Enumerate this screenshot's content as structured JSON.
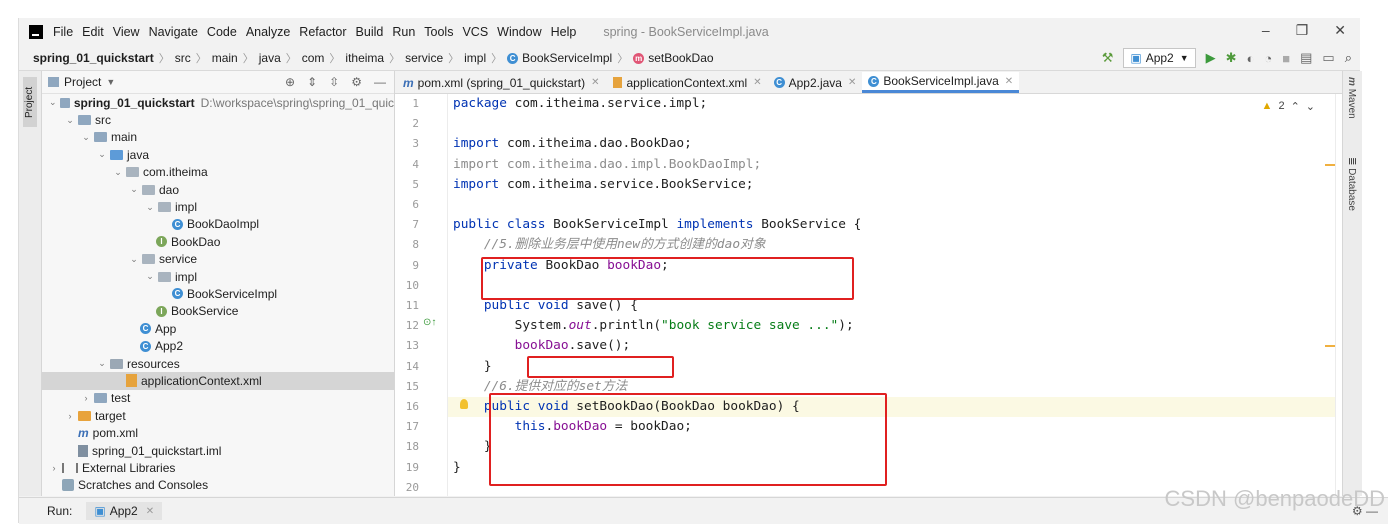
{
  "menu": {
    "items": [
      "File",
      "Edit",
      "View",
      "Navigate",
      "Code",
      "Analyze",
      "Refactor",
      "Build",
      "Run",
      "Tools",
      "VCS",
      "Window",
      "Help"
    ],
    "window_title": "spring - BookServiceImpl.java"
  },
  "navbar": {
    "crumbs": [
      "spring_01_quickstart",
      "src",
      "main",
      "java",
      "com",
      "itheima",
      "service",
      "impl"
    ],
    "class_crumb": "BookServiceImpl",
    "method_crumb": "setBookDao",
    "run_config": "App2"
  },
  "left_stripe": {
    "project_tab": "Project"
  },
  "project_panel": {
    "title": "Project",
    "tree": [
      {
        "label": "spring_01_quickstart",
        "path": "D:\\workspace\\spring\\spring_01_quic",
        "icon": "module-folder-icon",
        "indent": 0,
        "arrow": "down",
        "bold": true
      },
      {
        "label": "src",
        "icon": "folder-icon",
        "indent": 1,
        "arrow": "down"
      },
      {
        "label": "main",
        "icon": "folder-icon",
        "indent": 2,
        "arrow": "down"
      },
      {
        "label": "java",
        "icon": "source-folder-icon",
        "indent": 3,
        "arrow": "down"
      },
      {
        "label": "com.itheima",
        "icon": "package-icon",
        "indent": 4,
        "arrow": "down"
      },
      {
        "label": "dao",
        "icon": "package-icon",
        "indent": 5,
        "arrow": "down"
      },
      {
        "label": "impl",
        "icon": "package-icon",
        "indent": 6,
        "arrow": "down"
      },
      {
        "label": "BookDaoImpl",
        "icon": "class-icon",
        "indent": 7,
        "arrow": ""
      },
      {
        "label": "BookDao",
        "icon": "interface-icon",
        "indent": 6,
        "arrow": ""
      },
      {
        "label": "service",
        "icon": "package-icon",
        "indent": 5,
        "arrow": "down"
      },
      {
        "label": "impl",
        "icon": "package-icon",
        "indent": 6,
        "arrow": "down"
      },
      {
        "label": "BookServiceImpl",
        "icon": "class-icon",
        "indent": 7,
        "arrow": ""
      },
      {
        "label": "BookService",
        "icon": "interface-icon",
        "indent": 6,
        "arrow": ""
      },
      {
        "label": "App",
        "icon": "app-class-icon",
        "indent": 5,
        "arrow": ""
      },
      {
        "label": "App2",
        "icon": "app-class-icon",
        "indent": 5,
        "arrow": ""
      },
      {
        "label": "resources",
        "icon": "resources-folder-icon",
        "indent": 3,
        "arrow": "down"
      },
      {
        "label": "applicationContext.xml",
        "icon": "xml-file-icon",
        "indent": 4,
        "arrow": "",
        "selected": true
      },
      {
        "label": "test",
        "icon": "folder-icon",
        "indent": 2,
        "arrow": "right"
      },
      {
        "label": "target",
        "icon": "target-folder-icon",
        "indent": 1,
        "arrow": "right"
      },
      {
        "label": "pom.xml",
        "icon": "maven-file-icon",
        "indent": 1,
        "arrow": ""
      },
      {
        "label": "spring_01_quickstart.iml",
        "icon": "iml-file-icon",
        "indent": 1,
        "arrow": ""
      },
      {
        "label": "External Libraries",
        "icon": "libraries-icon",
        "indent": 0,
        "arrow": "right"
      },
      {
        "label": "Scratches and Consoles",
        "icon": "scratches-icon",
        "indent": 0,
        "arrow": ""
      }
    ]
  },
  "tabs": [
    {
      "label": "pom.xml (spring_01_quickstart)",
      "icon": "maven-file-icon",
      "active": false
    },
    {
      "label": "applicationContext.xml",
      "icon": "xml-file-icon",
      "active": false
    },
    {
      "label": "App2.java",
      "icon": "app-class-icon",
      "active": false
    },
    {
      "label": "BookServiceImpl.java",
      "icon": "class-icon",
      "active": true
    }
  ],
  "editor": {
    "warning_count": "2",
    "line_numbers": [
      "1",
      "2",
      "3",
      "4",
      "5",
      "6",
      "7",
      "8",
      "9",
      "10",
      "11",
      "12",
      "13",
      "14",
      "15",
      "16",
      "17",
      "18",
      "19",
      "20"
    ],
    "lines": [
      [
        {
          "t": "package ",
          "c": "kw"
        },
        {
          "t": "com.itheima.service.impl;",
          "c": ""
        }
      ],
      [],
      [
        {
          "t": "import ",
          "c": "kw"
        },
        {
          "t": "com.itheima.dao.BookDao;",
          "c": ""
        }
      ],
      [
        {
          "t": "import com.itheima.dao.impl.BookDaoImpl;",
          "c": "gr"
        }
      ],
      [
        {
          "t": "import ",
          "c": "kw"
        },
        {
          "t": "com.itheima.service.BookService;",
          "c": ""
        }
      ],
      [],
      [
        {
          "t": "public class ",
          "c": "kw"
        },
        {
          "t": "BookServiceImpl ",
          "c": ""
        },
        {
          "t": "implements ",
          "c": "kw"
        },
        {
          "t": "BookService {",
          "c": ""
        }
      ],
      [
        {
          "t": "    //5.删除业务层中使用new的方式创建的dao对象",
          "c": "cm"
        }
      ],
      [
        {
          "t": "    private ",
          "c": "kw"
        },
        {
          "t": "BookDao ",
          "c": ""
        },
        {
          "t": "bookDao",
          "c": "fld"
        },
        {
          "t": ";",
          "c": ""
        }
      ],
      [],
      [
        {
          "t": "    public void ",
          "c": "kw"
        },
        {
          "t": "save() {",
          "c": ""
        }
      ],
      [
        {
          "t": "        System.",
          "c": ""
        },
        {
          "t": "out",
          "c": "st"
        },
        {
          "t": ".println(",
          "c": ""
        },
        {
          "t": "\"book service save ...\"",
          "c": "str"
        },
        {
          "t": ");",
          "c": ""
        }
      ],
      [
        {
          "t": "        ",
          "c": ""
        },
        {
          "t": "bookDao",
          "c": "fld"
        },
        {
          "t": ".save();",
          "c": ""
        }
      ],
      [
        {
          "t": "    }",
          "c": ""
        }
      ],
      [
        {
          "t": "    //6.提供对应的set方法",
          "c": "cm"
        }
      ],
      [
        {
          "t": "    public void ",
          "c": "kw"
        },
        {
          "t": "setBookDao(BookDao bookDao) {",
          "c": ""
        }
      ],
      [
        {
          "t": "        ",
          "c": ""
        },
        {
          "t": "this",
          "c": "kw"
        },
        {
          "t": ".",
          "c": ""
        },
        {
          "t": "bookDao",
          "c": "fld"
        },
        {
          "t": " = bookDao;",
          "c": ""
        }
      ],
      [
        {
          "t": "    }",
          "c": ""
        }
      ],
      [
        {
          "t": "}",
          "c": ""
        }
      ],
      []
    ]
  },
  "right_stripe": {
    "maven": "Maven",
    "database": "Database"
  },
  "runbar": {
    "label": "Run:",
    "tab": "App2"
  },
  "watermark": "CSDN @benpaodeDD"
}
